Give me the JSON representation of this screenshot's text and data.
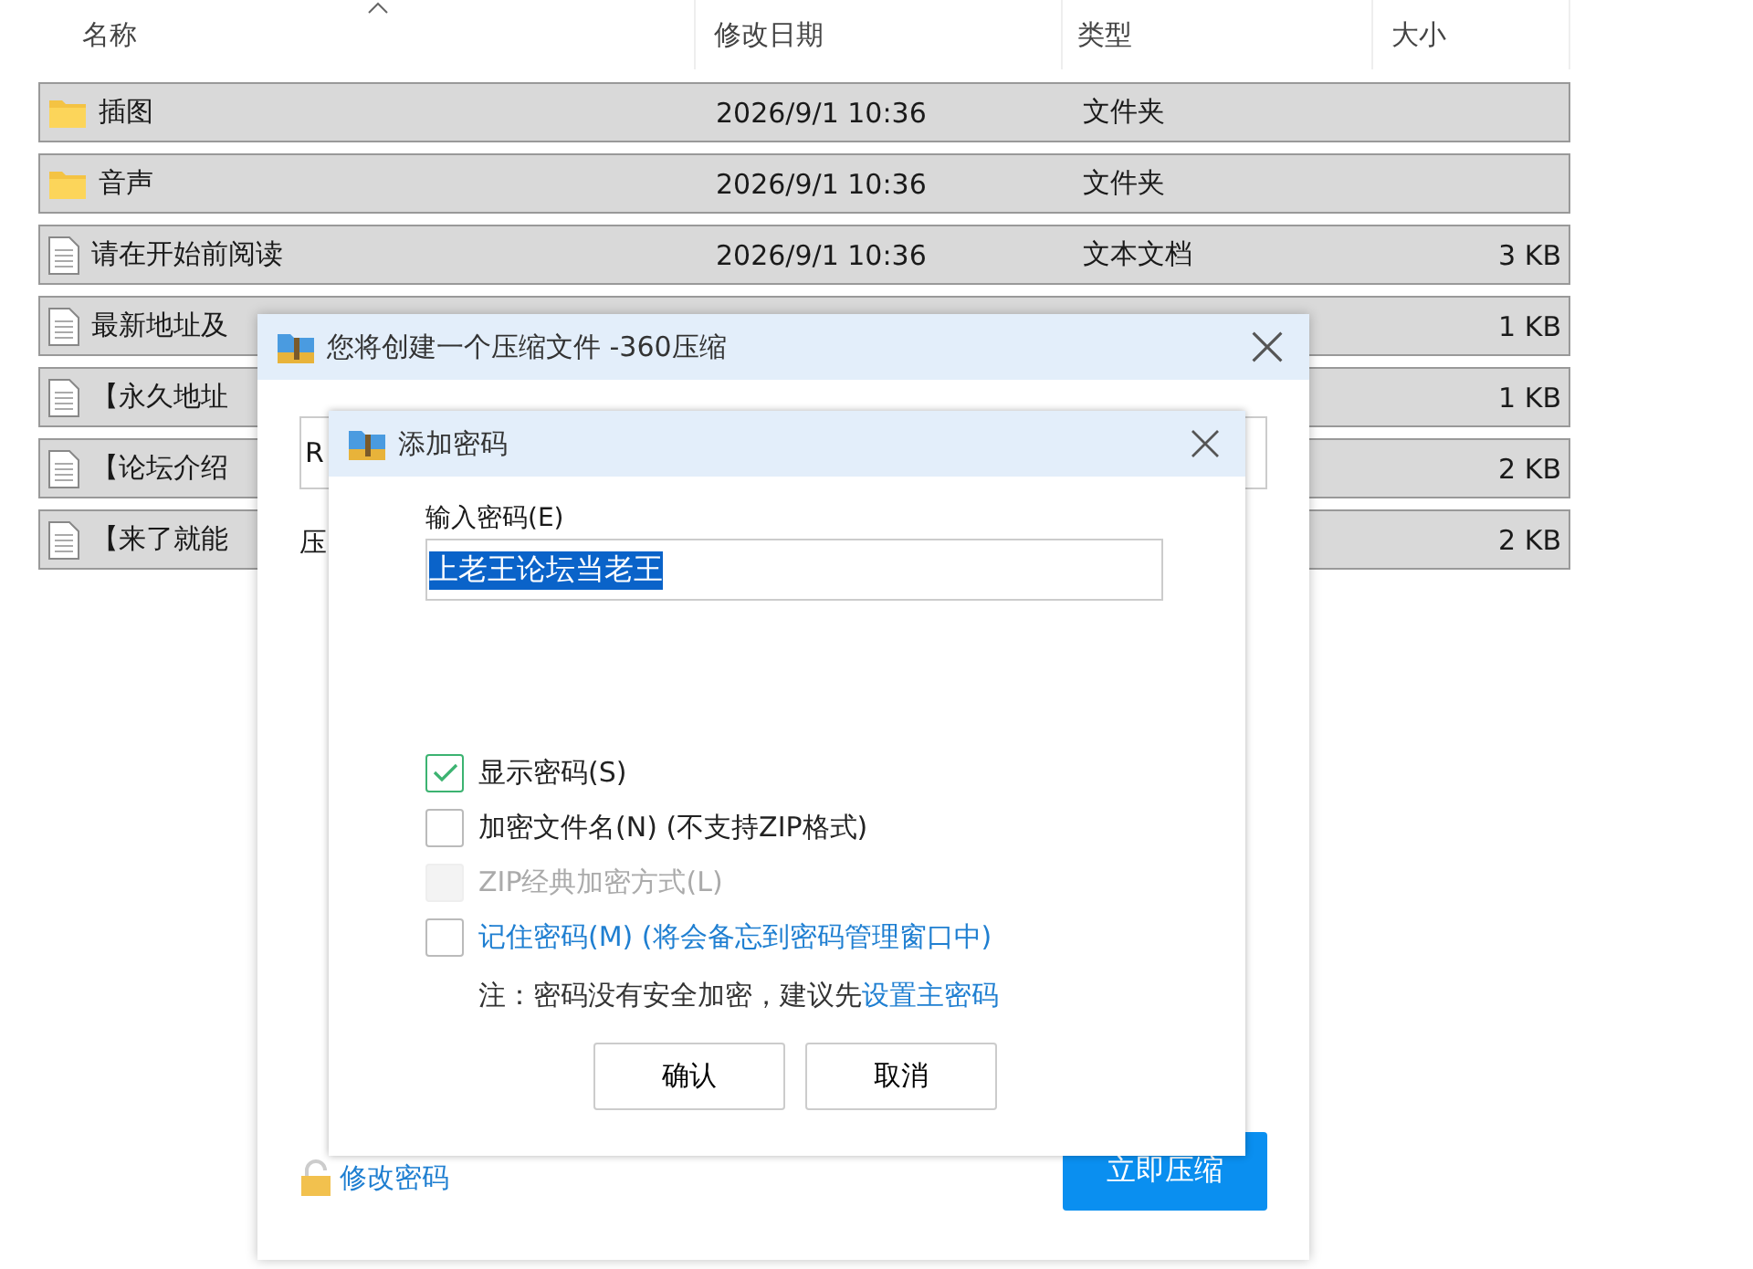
{
  "explorer": {
    "columns": [
      {
        "label": "名称",
        "sorted": true
      },
      {
        "label": "修改日期",
        "sorted": false
      },
      {
        "label": "类型",
        "sorted": false
      },
      {
        "label": "大小",
        "sorted": false
      }
    ],
    "rows": [
      {
        "kind": "folder",
        "name": "插图",
        "date": "2026/9/1 10:36",
        "type": "文件夹",
        "selected": true
      },
      {
        "kind": "folder",
        "name": "音声",
        "date": "2026/9/1 10:36",
        "type": "文件夹",
        "selected": true
      },
      {
        "kind": "text",
        "name": "请在开始前阅读",
        "date": "2026/9/1 10:36",
        "type": "文本文档",
        "size": "3 KB",
        "selected": true
      },
      {
        "kind": "text",
        "name": "最新地址及",
        "size": "1 KB",
        "selected": true
      },
      {
        "kind": "text",
        "name": "【永久地址",
        "size": "1 KB",
        "selected": true
      },
      {
        "kind": "text",
        "name": "【论坛介绍",
        "size": "2 KB",
        "selected": true
      },
      {
        "kind": "text",
        "name": "【来了就能",
        "size": "2 KB",
        "selected": true
      }
    ]
  },
  "compress_dialog": {
    "title": "您将创建一个压缩文件 -360压缩",
    "path_field": "R",
    "label_fragment": "压",
    "change_password": "修改密码",
    "compress_button": "立即压缩"
  },
  "password_dialog": {
    "title": "添加密码",
    "password_label": "输入密码(E)",
    "password": "上老王论坛当老王",
    "password_selected": true,
    "options": [
      {
        "label": "显示密码(S)",
        "checked": true,
        "disabled": false,
        "link": false
      },
      {
        "label": "加密文件名(N) (不支持ZIP格式)",
        "checked": false,
        "disabled": false,
        "link": false
      },
      {
        "label": "ZIP经典加密方式(L)",
        "checked": false,
        "disabled": true,
        "link": false
      },
      {
        "label": "记住密码(M) (将会备忘到密码管理窗口中)",
        "checked": false,
        "disabled": false,
        "link": true
      }
    ],
    "note": "注：密码没有安全加密，建议先",
    "note_link": "设置主密码",
    "buttons": [
      "确认",
      "取消"
    ]
  }
}
